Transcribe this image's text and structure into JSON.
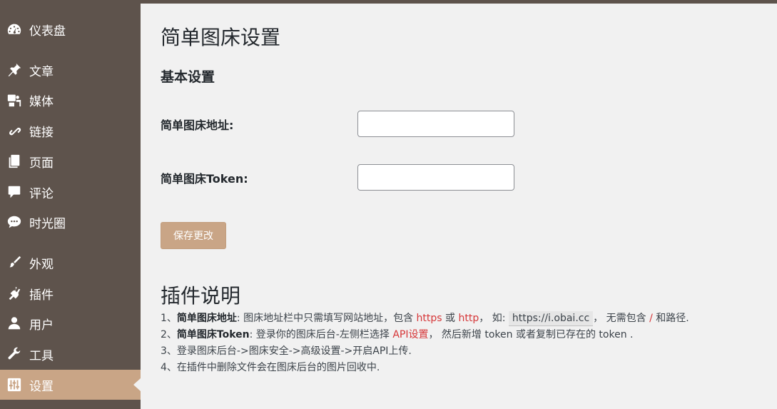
{
  "sidebar": {
    "items": [
      {
        "label": "仪表盘",
        "icon": "dashboard-icon"
      },
      {
        "label": "文章",
        "icon": "pin-icon"
      },
      {
        "label": "媒体",
        "icon": "media-icon"
      },
      {
        "label": "链接",
        "icon": "link-icon"
      },
      {
        "label": "页面",
        "icon": "page-icon"
      },
      {
        "label": "评论",
        "icon": "comment-icon"
      },
      {
        "label": "时光圈",
        "icon": "chat-bubbles-icon"
      },
      {
        "label": "外观",
        "icon": "brush-icon"
      },
      {
        "label": "插件",
        "icon": "plugin-icon"
      },
      {
        "label": "用户",
        "icon": "user-icon"
      },
      {
        "label": "工具",
        "icon": "wrench-icon"
      },
      {
        "label": "设置",
        "icon": "settings-icon",
        "active": true
      }
    ]
  },
  "page": {
    "title": "简单图床设置",
    "section_title": "基本设置",
    "fields": [
      {
        "label": "简单图床地址:",
        "value": ""
      },
      {
        "label": "简单图床Token:",
        "value": ""
      }
    ],
    "save_label": "保存更改"
  },
  "description": {
    "title": "插件说明",
    "line1": {
      "prefix": "1、",
      "bold": "简单图床地址",
      "text1": ": 图床地址栏中只需填写网站地址，包含 ",
      "https": "https",
      "or": " 或 ",
      "http": "http",
      "text2": "， 如: ",
      "example": "https://i.obai.cc",
      "text3": "， 无需包含 ",
      "slash": "/",
      "text4": " 和路径."
    },
    "line2": {
      "prefix": "2、",
      "bold": "简单图床Token",
      "text1": ": 登录你的图床后台-左侧栏选择 ",
      "api": "API设置",
      "text2": "， 然后新增 token 或者复制已存在的 token ."
    },
    "line3": "3、登录图床后台->图床安全->高级设置->开启API上传.",
    "line4": "4、在插件中删除文件会在图床后台的图片回收中."
  },
  "colors": {
    "sidebar_bg": "#5e534c",
    "accent": "#c9a586",
    "link_red": "#d63638"
  }
}
